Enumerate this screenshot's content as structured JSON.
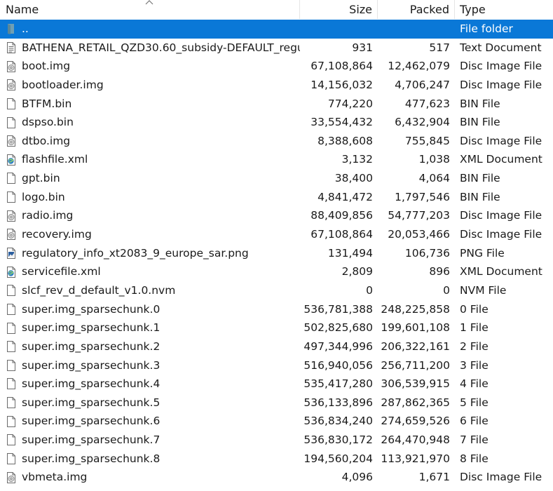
{
  "columns": {
    "name": "Name",
    "size": "Size",
    "packed": "Packed",
    "type": "Type"
  },
  "sort_indicator": "^",
  "rows": [
    {
      "name": "..",
      "size": "",
      "packed": "",
      "type": "File folder",
      "icon": "folder-icon",
      "selected": true
    },
    {
      "name": "BATHENA_RETAIL_QZD30.60_subsidy-DEFAULT_regu...",
      "size": "931",
      "packed": "517",
      "type": "Text Document",
      "icon": "text-file-icon"
    },
    {
      "name": "boot.img",
      "size": "67,108,864",
      "packed": "12,462,079",
      "type": "Disc Image File",
      "icon": "disc-image-icon"
    },
    {
      "name": "bootloader.img",
      "size": "14,156,032",
      "packed": "4,706,247",
      "type": "Disc Image File",
      "icon": "disc-image-icon"
    },
    {
      "name": "BTFM.bin",
      "size": "774,220",
      "packed": "477,623",
      "type": "BIN File",
      "icon": "blank-file-icon"
    },
    {
      "name": "dspso.bin",
      "size": "33,554,432",
      "packed": "6,432,904",
      "type": "BIN File",
      "icon": "blank-file-icon"
    },
    {
      "name": "dtbo.img",
      "size": "8,388,608",
      "packed": "755,845",
      "type": "Disc Image File",
      "icon": "disc-image-icon"
    },
    {
      "name": "flashfile.xml",
      "size": "3,132",
      "packed": "1,038",
      "type": "XML Document",
      "icon": "xml-file-icon"
    },
    {
      "name": "gpt.bin",
      "size": "38,400",
      "packed": "4,064",
      "type": "BIN File",
      "icon": "blank-file-icon"
    },
    {
      "name": "logo.bin",
      "size": "4,841,472",
      "packed": "1,797,546",
      "type": "BIN File",
      "icon": "blank-file-icon"
    },
    {
      "name": "radio.img",
      "size": "88,409,856",
      "packed": "54,777,203",
      "type": "Disc Image File",
      "icon": "disc-image-icon"
    },
    {
      "name": "recovery.img",
      "size": "67,108,864",
      "packed": "20,053,466",
      "type": "Disc Image File",
      "icon": "disc-image-icon"
    },
    {
      "name": "regulatory_info_xt2083_9_europe_sar.png",
      "size": "131,494",
      "packed": "106,736",
      "type": "PNG File",
      "icon": "image-file-icon"
    },
    {
      "name": "servicefile.xml",
      "size": "2,809",
      "packed": "896",
      "type": "XML Document",
      "icon": "xml-file-icon"
    },
    {
      "name": "slcf_rev_d_default_v1.0.nvm",
      "size": "0",
      "packed": "0",
      "type": "NVM File",
      "icon": "blank-file-icon"
    },
    {
      "name": "super.img_sparsechunk.0",
      "size": "536,781,388",
      "packed": "248,225,858",
      "type": "0 File",
      "icon": "blank-file-icon"
    },
    {
      "name": "super.img_sparsechunk.1",
      "size": "502,825,680",
      "packed": "199,601,108",
      "type": "1 File",
      "icon": "blank-file-icon"
    },
    {
      "name": "super.img_sparsechunk.2",
      "size": "497,344,996",
      "packed": "206,322,161",
      "type": "2 File",
      "icon": "blank-file-icon"
    },
    {
      "name": "super.img_sparsechunk.3",
      "size": "516,940,056",
      "packed": "256,711,200",
      "type": "3 File",
      "icon": "blank-file-icon"
    },
    {
      "name": "super.img_sparsechunk.4",
      "size": "535,417,280",
      "packed": "306,539,915",
      "type": "4 File",
      "icon": "blank-file-icon"
    },
    {
      "name": "super.img_sparsechunk.5",
      "size": "536,133,896",
      "packed": "287,862,365",
      "type": "5 File",
      "icon": "blank-file-icon"
    },
    {
      "name": "super.img_sparsechunk.6",
      "size": "536,834,240",
      "packed": "274,659,526",
      "type": "6 File",
      "icon": "blank-file-icon"
    },
    {
      "name": "super.img_sparsechunk.7",
      "size": "536,830,172",
      "packed": "264,470,948",
      "type": "7 File",
      "icon": "blank-file-icon"
    },
    {
      "name": "super.img_sparsechunk.8",
      "size": "194,560,204",
      "packed": "113,921,970",
      "type": "8 File",
      "icon": "blank-file-icon"
    },
    {
      "name": "vbmeta.img",
      "size": "4,096",
      "packed": "1,671",
      "type": "Disc Image File",
      "icon": "disc-image-icon"
    }
  ],
  "colors": {
    "selection": "#0a78d7",
    "selection_text": "#ffffff"
  }
}
